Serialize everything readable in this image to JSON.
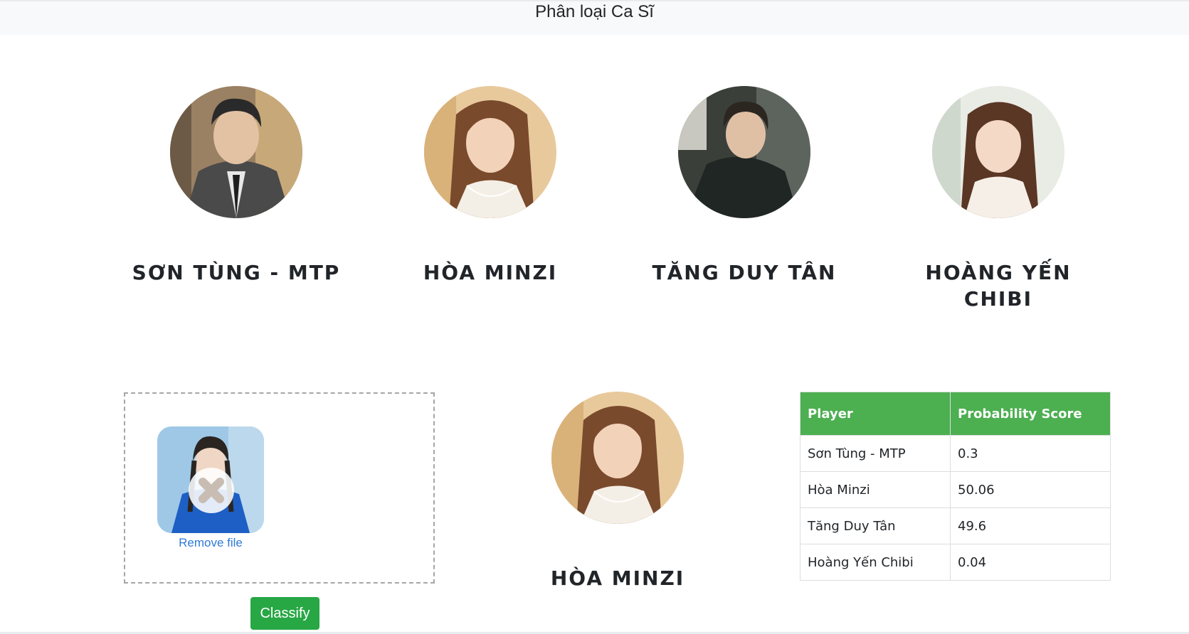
{
  "navbar": {
    "title": "Phân loại Ca Sĩ"
  },
  "singers": [
    {
      "name": "SƠN TÙNG - MTP",
      "icon": "portrait-son-tung-icon"
    },
    {
      "name": "HÒA MINZI",
      "icon": "portrait-hoa-minzi-icon"
    },
    {
      "name": "TĂNG DUY TÂN",
      "icon": "portrait-tang-duy-tan-icon"
    },
    {
      "name": "HOÀNG YẾN CHIBI",
      "icon": "portrait-hoang-yen-chibi-icon"
    }
  ],
  "upload": {
    "remove_label": "Remove file",
    "classify_label": "Classify"
  },
  "result": {
    "name": "HÒA MINZI"
  },
  "table": {
    "headers": [
      "Player",
      "Probability Score"
    ],
    "rows": [
      {
        "player": "Sơn Tùng - MTP",
        "score": "0.3"
      },
      {
        "player": "Hòa Minzi",
        "score": "50.06"
      },
      {
        "player": "Tăng Duy Tân",
        "score": "49.6"
      },
      {
        "player": "Hoàng Yến Chibi",
        "score": "0.04"
      }
    ]
  },
  "colors": {
    "accent_green": "#28a745",
    "table_header": "#4caf50",
    "link_blue": "#2f7bd6"
  }
}
